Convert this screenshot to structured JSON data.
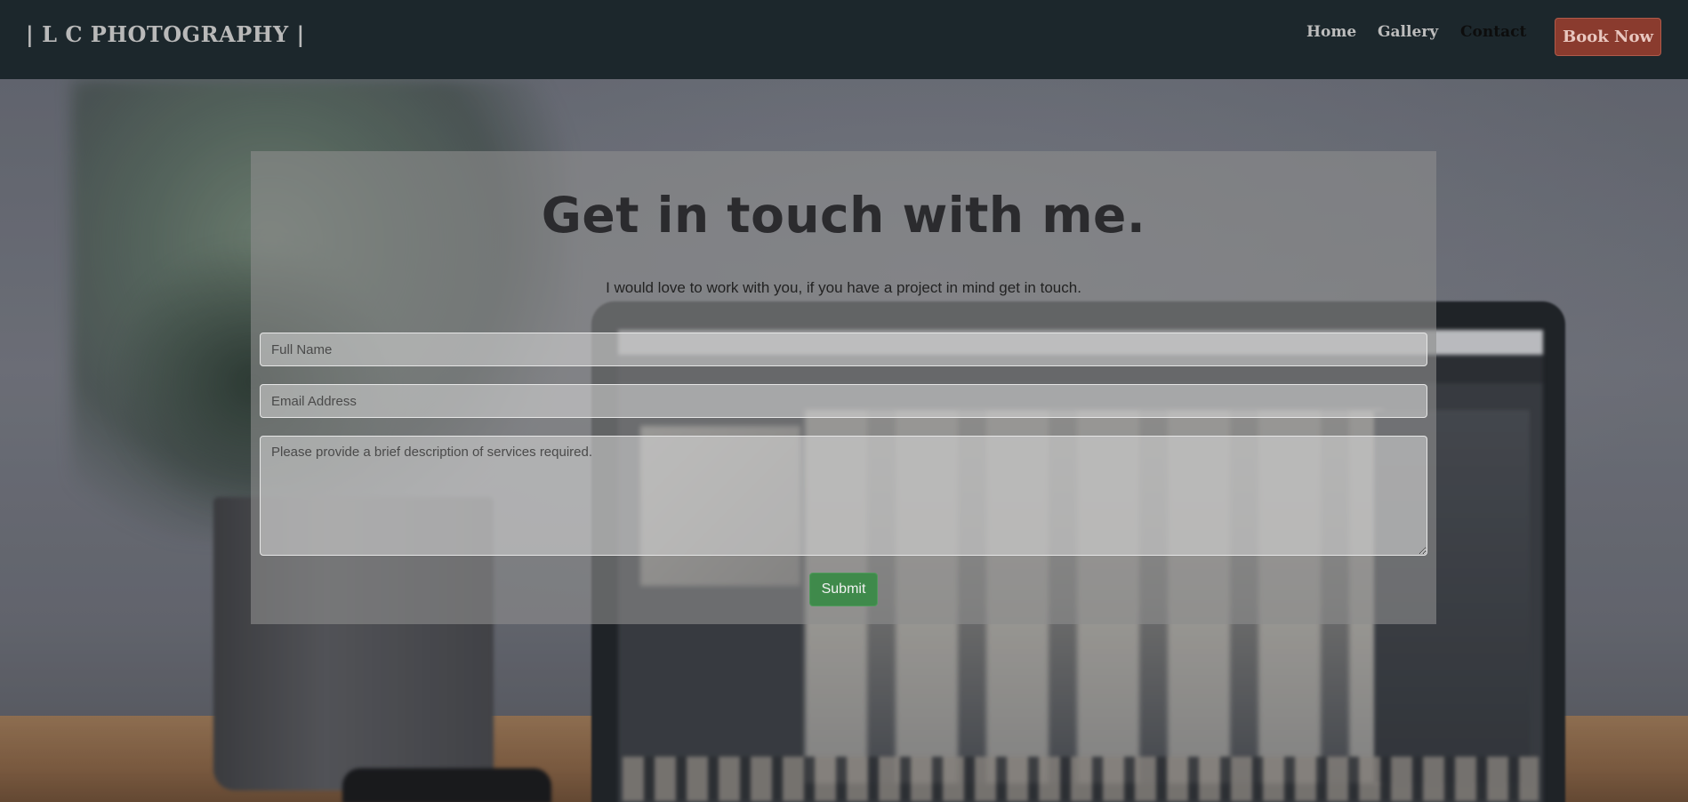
{
  "navbar": {
    "brand": "| L C PHOTOGRAPHY |",
    "links": [
      {
        "label": "Home"
      },
      {
        "label": "Gallery"
      },
      {
        "label": "Contact"
      }
    ],
    "book_button": "Book Now"
  },
  "contact": {
    "title": "Get in touch with me.",
    "subtitle": "I would love to work with you, if you have a project in mind get in touch.",
    "fields": {
      "name_placeholder": "Full Name",
      "email_placeholder": "Email Address",
      "message_placeholder": "Please provide a brief description of services required."
    },
    "submit_label": "Submit"
  },
  "colors": {
    "navbar_bg": "#1c272c",
    "book_button_bg": "#8a3b2e",
    "submit_bg": "#3f8a4b",
    "panel_overlay": "rgba(140,140,140,0.62)"
  },
  "background_image": "blurred desk with plant and laptop"
}
